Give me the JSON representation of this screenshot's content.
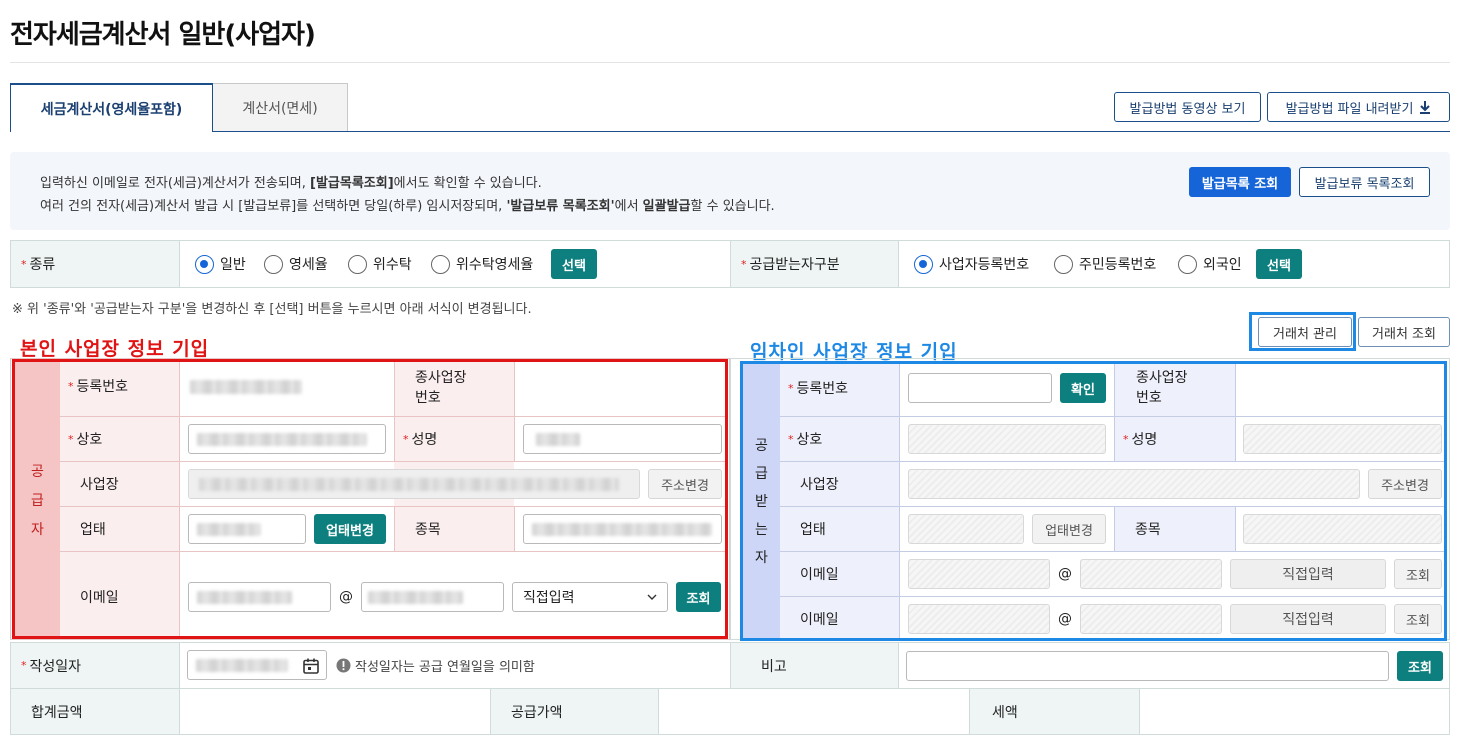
{
  "title": "전자세금계산서 일반(사업자)",
  "tabs": [
    {
      "label": "세금계산서(영세율포함)",
      "active": true
    },
    {
      "label": "계산서(면세)",
      "active": false
    }
  ],
  "help_buttons": {
    "video": "발급방법 동영상 보기",
    "file": "발급방법 파일 내려받기"
  },
  "notice": {
    "line1_a": "입력하신 이메일로 전자(세금)계산서가 전송되며, ",
    "line1_b": "[발급목록조회]",
    "line1_c": "에서도 확인할 수 있습니다.",
    "line2_a": "여러 건의 전자(세금)계산서 발급 시 [발급보류]를 선택하면 당일(하루) 임시저장되며, ",
    "line2_b": "'발급보류 목록조회'",
    "line2_c": "에서 ",
    "line2_d": "일괄발급",
    "line2_e": "할 수 있습니다.",
    "btn_list": "발급목록 조회",
    "btn_hold": "발급보류 목록조회"
  },
  "type_row": {
    "kind_label": "종류",
    "kind_options": [
      "일반",
      "영세율",
      "위수탁",
      "위수탁영세율"
    ],
    "kind_selected": "일반",
    "select_btn": "선택",
    "recv_label": "공급받는자구분",
    "recv_options": [
      "사업자등록번호",
      "주민등록번호",
      "외국인"
    ],
    "recv_selected": "사업자등록번호"
  },
  "note": "※ 위 '종류'와 '공급받는자 구분'을 변경하신 후 [선택] 버튼을 누르시면 아래 서식이 변경됩니다.",
  "annot_left": "본인 사업장 정보 기입",
  "annot_right": "임차인 사업장 정보 기입",
  "partner_buttons": {
    "manage": "거래처 관리",
    "lookup": "거래처 조회"
  },
  "supplier": {
    "side_label": [
      "공",
      "급",
      "자"
    ],
    "reg_no_label": "등록번호",
    "branch_label": [
      "종사업장",
      "번호"
    ],
    "name_label": "상호",
    "ceo_label": "성명",
    "address_label": "사업장",
    "address_btn": "주소변경",
    "biz_type_label": "업태",
    "biz_type_btn": "업태변경",
    "item_label": "종목",
    "email_label": "이메일",
    "at": "@",
    "domain_select": "직접입력",
    "lookup_btn": "조회"
  },
  "receiver": {
    "side_label": [
      "공",
      "급",
      "받",
      "는",
      "자"
    ],
    "reg_no_label": "등록번호",
    "confirm_btn": "확인",
    "branch_label": [
      "종사업장",
      "번호"
    ],
    "name_label": "상호",
    "ceo_label": "성명",
    "address_label": "사업장",
    "address_btn": "주소변경",
    "biz_type_label": "업태",
    "biz_type_btn": "업태변경",
    "item_label": "종목",
    "email_label": "이메일",
    "at": "@",
    "domain_select": "직접입력",
    "lookup_btn": "조회"
  },
  "date_row": {
    "label": "작성일자",
    "hint": "작성일자는 공급 연월일을 의미함",
    "memo_label": "비고",
    "memo_btn": "조회"
  },
  "total_row": {
    "total_label": "합계금액",
    "supply_label": "공급가액",
    "tax_label": "세액"
  },
  "colors": {
    "primary": "#1565d8",
    "teal": "#0d7f7f",
    "navy": "#1a4f8b",
    "red_annot": "#e01414",
    "blue_annot": "#1e88e5"
  },
  "icons": [
    "download-icon",
    "calendar-icon",
    "info-icon",
    "chevron-down-icon"
  ]
}
